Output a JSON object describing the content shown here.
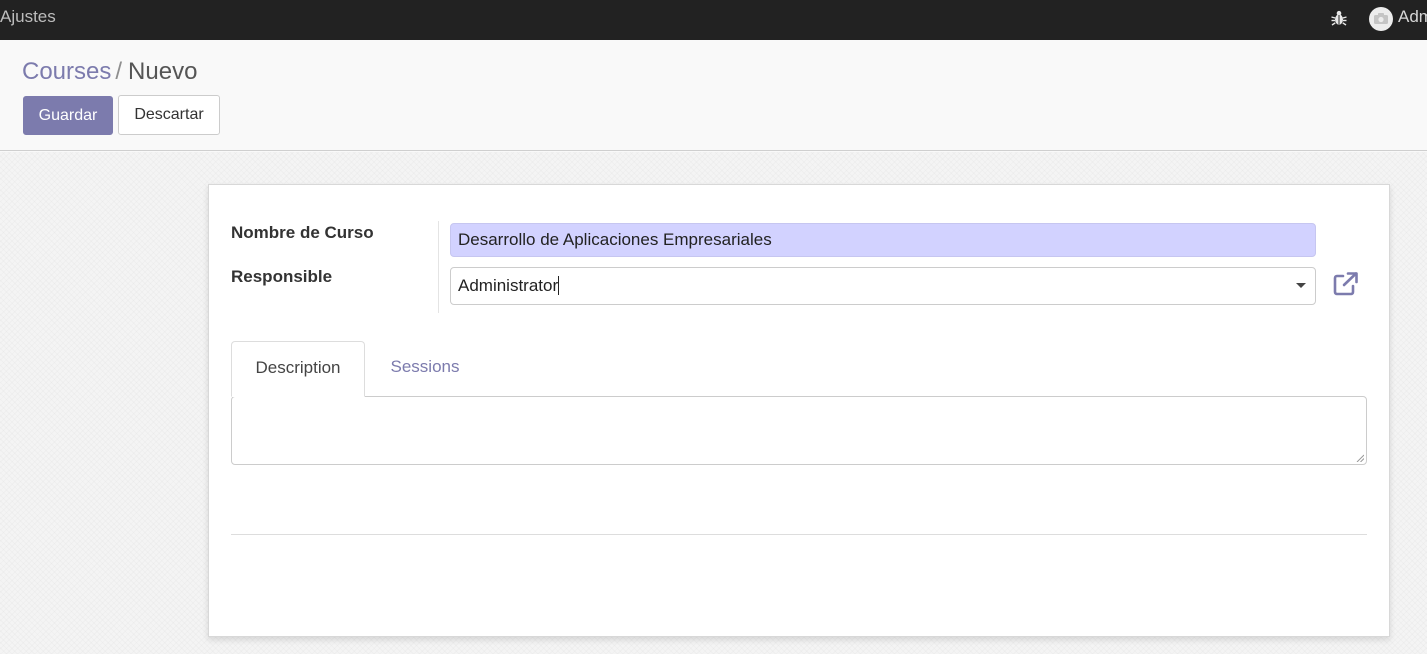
{
  "navbar": {
    "title": "Ajustes",
    "user_name": "Administrator",
    "debug_icon": "bug-icon",
    "avatar_icon": "camera-icon"
  },
  "breadcrumb": {
    "parent": "Courses",
    "separator": "/",
    "current": "Nuevo"
  },
  "buttons": {
    "save": "Guardar",
    "discard": "Descartar"
  },
  "form": {
    "fields": {
      "name_label": "Nombre de Curso",
      "name_value": "Desarrollo de Aplicaciones Empresariales",
      "responsible_label": "Responsible",
      "responsible_value": "Administrator"
    },
    "tabs": [
      {
        "label": "Description",
        "active": true
      },
      {
        "label": "Sessions",
        "active": false
      }
    ],
    "description_value": ""
  },
  "colors": {
    "accent": "#7c7bad",
    "navbar": "#222222",
    "required_field_bg": "#d2d2ff"
  }
}
